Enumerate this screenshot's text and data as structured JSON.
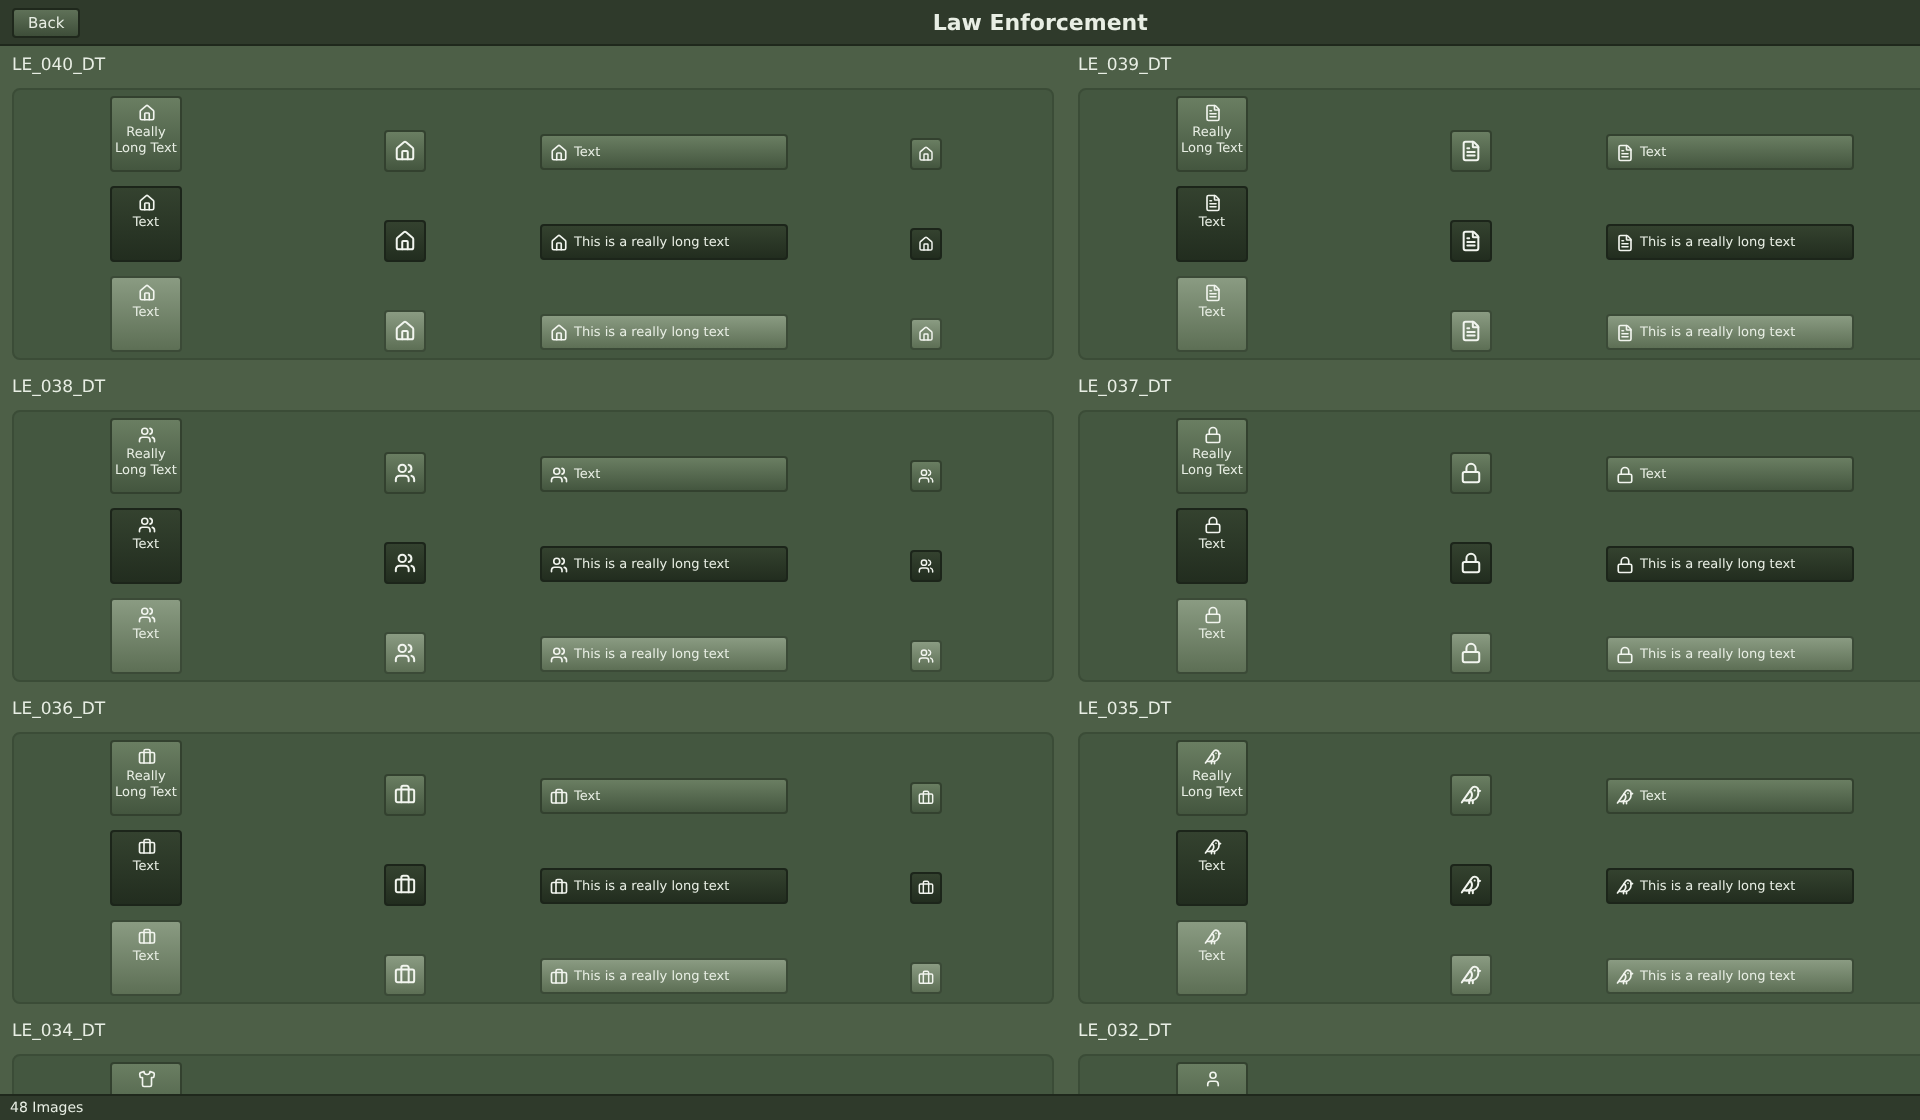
{
  "header": {
    "back_button": "Back",
    "title": "Law Enforcement"
  },
  "sections": [
    {
      "name": "LE_040_DT",
      "rows": [
        {
          "pressed": false,
          "hovered": false,
          "tile_label": "Really Long Text",
          "bar_label": "Text"
        },
        {
          "pressed": true,
          "hovered": false,
          "tile_label": "Text",
          "bar_label": "This is a really long text"
        },
        {
          "pressed": false,
          "hovered": true,
          "tile_label": "Text",
          "bar_label": "This is a really long text"
        }
      ]
    },
    {
      "name": "LE_039_DT",
      "rows": [
        {
          "pressed": false,
          "hovered": false,
          "tile_label": "Really Long Text",
          "bar_label": "Text"
        },
        {
          "pressed": true,
          "hovered": false,
          "tile_label": "Text",
          "bar_label": "This is a really long text"
        },
        {
          "pressed": false,
          "hovered": true,
          "tile_label": "Text",
          "bar_label": "This is a really long text"
        }
      ]
    },
    {
      "name": "LE_038_DT",
      "rows": [
        {
          "pressed": false,
          "hovered": false,
          "tile_label": "Really Long Text",
          "bar_label": "Text"
        },
        {
          "pressed": true,
          "hovered": false,
          "tile_label": "Text",
          "bar_label": "This is a really long text"
        },
        {
          "pressed": false,
          "hovered": true,
          "tile_label": "Text",
          "bar_label": "This is a really long text"
        }
      ]
    },
    {
      "name": "LE_037_DT",
      "rows": [
        {
          "pressed": false,
          "hovered": false,
          "tile_label": "Really Long Text",
          "bar_label": "Text"
        },
        {
          "pressed": true,
          "hovered": false,
          "tile_label": "Text",
          "bar_label": "This is a really long text"
        },
        {
          "pressed": false,
          "hovered": true,
          "tile_label": "Text",
          "bar_label": "This is a really long text"
        }
      ]
    },
    {
      "name": "LE_036_DT",
      "rows": [
        {
          "pressed": false,
          "hovered": false,
          "tile_label": "Really Long Text",
          "bar_label": "Text"
        },
        {
          "pressed": true,
          "hovered": false,
          "tile_label": "Text",
          "bar_label": "This is a really long text"
        },
        {
          "pressed": false,
          "hovered": true,
          "tile_label": "Text",
          "bar_label": "This is a really long text"
        }
      ]
    },
    {
      "name": "LE_035_DT",
      "rows": [
        {
          "pressed": false,
          "hovered": false,
          "tile_label": "Really Long Text",
          "bar_label": "Text"
        },
        {
          "pressed": true,
          "hovered": false,
          "tile_label": "Text",
          "bar_label": "This is a really long text"
        },
        {
          "pressed": false,
          "hovered": true,
          "tile_label": "Text",
          "bar_label": "This is a really long text"
        }
      ]
    },
    {
      "name": "LE_034_DT",
      "rows": [
        {
          "pressed": false,
          "hovered": false
        }
      ]
    },
    {
      "name": "LE_032_DT",
      "rows": [
        {
          "pressed": false,
          "hovered": false
        }
      ]
    }
  ],
  "status_bar": "48 Images"
}
